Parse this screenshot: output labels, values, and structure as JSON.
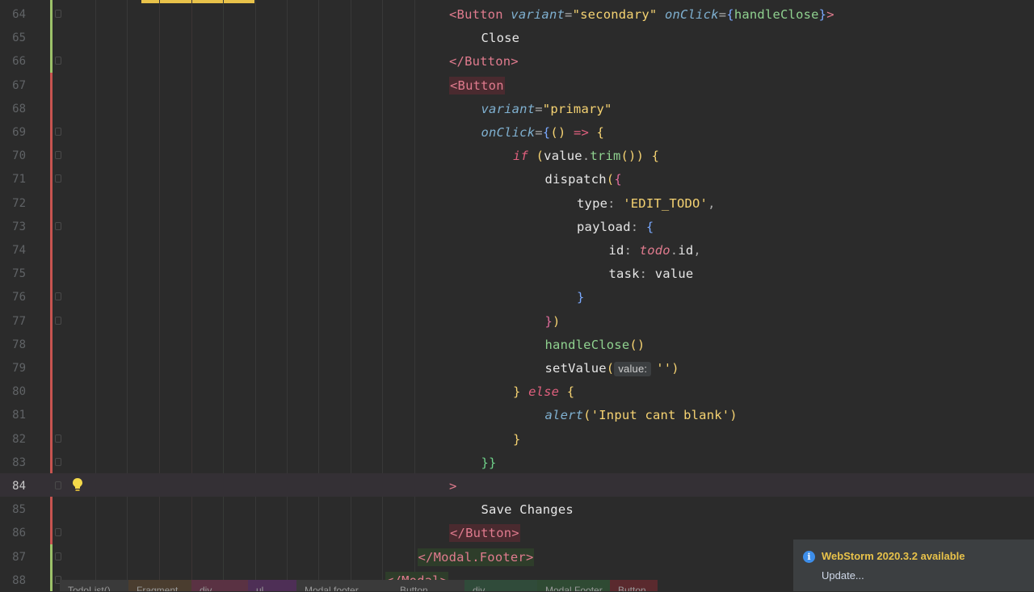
{
  "colors": {
    "editor_bg": "#2b2b2b",
    "current_line_bg": "#343035",
    "vcs_modified": "#6a8759",
    "vcs_changed": "#c75450",
    "notification_title": "#e8c24a"
  },
  "lines": [
    {
      "num": "64",
      "indent": 0
    },
    {
      "num": "65",
      "indent": 1
    },
    {
      "num": "66",
      "indent": 0
    },
    {
      "num": "67",
      "indent": 0
    },
    {
      "num": "68",
      "indent": 1
    },
    {
      "num": "69",
      "indent": 1
    },
    {
      "num": "70",
      "indent": 2
    },
    {
      "num": "71",
      "indent": 3
    },
    {
      "num": "72",
      "indent": 4
    },
    {
      "num": "73",
      "indent": 4
    },
    {
      "num": "74",
      "indent": 5
    },
    {
      "num": "75",
      "indent": 5
    },
    {
      "num": "76",
      "indent": 4
    },
    {
      "num": "77",
      "indent": 3
    },
    {
      "num": "78",
      "indent": 3
    },
    {
      "num": "79",
      "indent": 3
    },
    {
      "num": "80",
      "indent": 2
    },
    {
      "num": "81",
      "indent": 3
    },
    {
      "num": "82",
      "indent": 2
    },
    {
      "num": "83",
      "indent": 1
    },
    {
      "num": "84",
      "indent": 0
    },
    {
      "num": "85",
      "indent": 1
    },
    {
      "num": "86",
      "indent": 0
    },
    {
      "num": "87",
      "indent": -1
    },
    {
      "num": "88",
      "indent": -2
    }
  ],
  "code": {
    "l64": {
      "open": "<",
      "tag": "Button",
      "attr1": "variant",
      "eq1": "=",
      "val1": "\"secondary\"",
      "attr2": "onClick",
      "eq2": "=",
      "brace_open": "{",
      "handler": "handleClose",
      "brace_close": "}",
      "close": ">"
    },
    "l65": {
      "text": "Close"
    },
    "l66": {
      "text": "</Button>"
    },
    "l67": {
      "text": "<Button"
    },
    "l68": {
      "attr": "variant",
      "eq": "=",
      "val": "\"primary\""
    },
    "l69": {
      "attr": "onClick",
      "eq": "=",
      "brace": "{",
      "parens": "()",
      "arrow": " => ",
      "body_brace": "{"
    },
    "l70": {
      "kw": "if",
      "p_open": " (",
      "obj": "value",
      "dot": ".",
      "fn": "trim",
      "call": "()",
      "p_close": ")",
      "brace": " {"
    },
    "l71": {
      "fn": "dispatch",
      "p_open": "(",
      "brace": "{"
    },
    "l72": {
      "key": "type",
      "colon": ": ",
      "val": "'EDIT_TODO'",
      "comma": ","
    },
    "l73": {
      "key": "payload",
      "colon": ": ",
      "brace": "{"
    },
    "l74": {
      "key": "id",
      "colon": ": ",
      "obj": "todo",
      "dot": ".",
      "prop": "id",
      "comma": ","
    },
    "l75": {
      "key": "task",
      "colon": ": ",
      "val": "value"
    },
    "l76": {
      "brace": "}"
    },
    "l77": {
      "brace": "}",
      "paren": ")"
    },
    "l78": {
      "fn": "handleClose",
      "call": "()"
    },
    "l79": {
      "fn": "setValue",
      "p_open": "(",
      "hint": "value:",
      "val": "''",
      "p_close": ")"
    },
    "l80": {
      "brace": "}",
      "kw": " else",
      "brace2": " {"
    },
    "l81": {
      "fn": "alert",
      "p_open": "(",
      "val": "'Input cant blank'",
      "p_close": ")"
    },
    "l82": {
      "brace": "}"
    },
    "l83": {
      "text": "}}"
    },
    "l84": {
      "text": ">"
    },
    "l85": {
      "text": "Save Changes"
    },
    "l86": {
      "text": "</Button>"
    },
    "l87": {
      "text": "</Modal.Footer>"
    },
    "l88": {
      "text": "</Modal>"
    }
  },
  "breadcrumbs": [
    "TodoList()",
    "Fragment",
    "div",
    "ul",
    "Modal.footer",
    "Button",
    "div",
    "Modal.Footer",
    "Button"
  ],
  "notification": {
    "icon": "info-icon",
    "title": "WebStorm 2020.3.2 available",
    "link": "Update..."
  }
}
